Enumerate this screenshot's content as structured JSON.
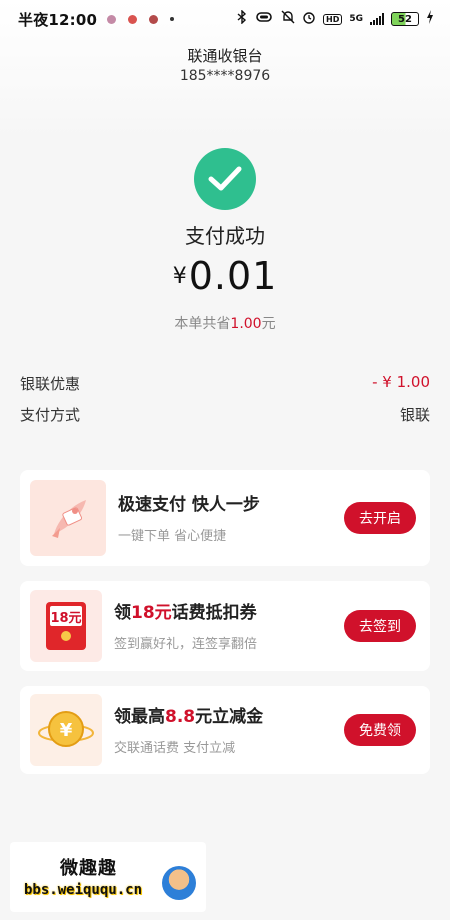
{
  "status_bar": {
    "time": "半夜12:00",
    "network": "5G",
    "battery": "52",
    "hd": "HD"
  },
  "header": {
    "title": "联通收银台",
    "phone": "185****8976"
  },
  "result": {
    "title": "支付成功",
    "currency": "¥",
    "amount": "0.01",
    "saved_prefix": "本单共省",
    "saved_amount": "1.00",
    "saved_suffix": "元"
  },
  "details": [
    {
      "label": "银联优惠",
      "value": "- ¥ 1.00"
    },
    {
      "label": "支付方式",
      "value": "银联"
    }
  ],
  "cards": [
    {
      "title": "极速支付  快人一步",
      "subtitle": "一键下单 省心便捷",
      "button": "去开启",
      "icon": "rocket-icon"
    },
    {
      "title_prefix": "领",
      "title_highlight": "18元",
      "title_suffix": "话费抵扣券",
      "subtitle": "签到赢好礼，连签享翻倍",
      "button": "去签到",
      "icon": "coupon-envelope-icon",
      "coupon_label": "18元"
    },
    {
      "title_prefix": "领最高",
      "title_highlight": "8.8",
      "title_suffix": "元立减金",
      "subtitle": "交联通话费 支付立减",
      "button": "免费领",
      "icon": "gold-coin-icon",
      "coin_label": "¥"
    }
  ],
  "watermark": {
    "title": "微趣趣",
    "url": "bbs.weiququ.cn"
  },
  "colors": {
    "accent": "#d0112b",
    "success": "#2fbf8f"
  }
}
